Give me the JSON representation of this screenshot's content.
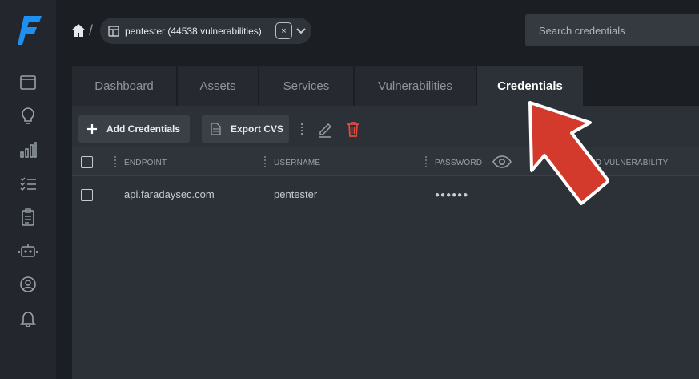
{
  "sidebar": {
    "logo": "faraday-logo",
    "items": [
      {
        "icon": "window-icon"
      },
      {
        "icon": "lightbulb-icon"
      },
      {
        "icon": "bar-chart-icon"
      },
      {
        "icon": "checklist-icon"
      },
      {
        "icon": "clipboard-icon"
      },
      {
        "icon": "robot-icon"
      },
      {
        "icon": "user-circle-icon"
      },
      {
        "icon": "bell-icon"
      }
    ]
  },
  "topbar": {
    "breadcrumb_separator": "/",
    "workspace_label": "pentester (44538 vulnerabilities)",
    "close_glyph": "×",
    "search_placeholder": "Search credentials"
  },
  "tabs": [
    {
      "label": "Dashboard",
      "active": false
    },
    {
      "label": "Assets",
      "active": false
    },
    {
      "label": "Services",
      "active": false
    },
    {
      "label": "Vulnerabilities",
      "active": false
    },
    {
      "label": "Credentials",
      "active": true
    }
  ],
  "toolbar": {
    "add_label": "Add Credentials",
    "export_label": "Export CVS"
  },
  "table": {
    "columns": [
      "ENDPOINT",
      "USERNAME",
      "PASSWORD",
      "KED VULNERABILITY"
    ],
    "rows": [
      {
        "endpoint": "api.faradaysec.com",
        "username": "pentester",
        "password": "●●●●●●"
      }
    ]
  },
  "colors": {
    "accent_danger": "#e04a3f",
    "arrow_red": "#d33a2c"
  }
}
